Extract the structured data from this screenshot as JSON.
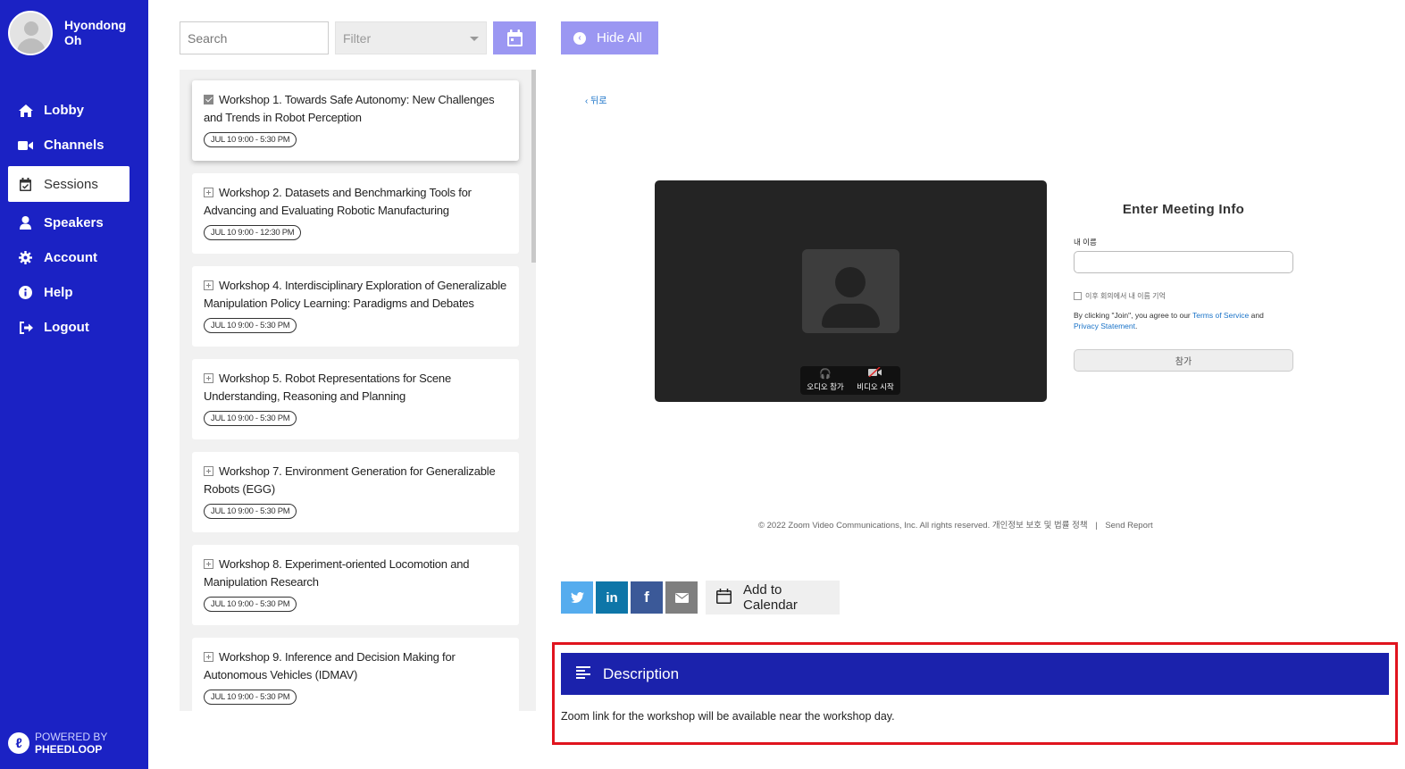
{
  "user": {
    "name": "Hyondong Oh"
  },
  "nav": {
    "items": [
      {
        "label": "Lobby",
        "icon": "home-icon"
      },
      {
        "label": "Channels",
        "icon": "video-camera-icon"
      },
      {
        "label": "Sessions",
        "icon": "calendar-check-icon",
        "active": true
      },
      {
        "label": "Speakers",
        "icon": "user-icon"
      },
      {
        "label": "Account",
        "icon": "gear-icon"
      },
      {
        "label": "Help",
        "icon": "info-icon"
      },
      {
        "label": "Logout",
        "icon": "sign-out-icon"
      }
    ]
  },
  "powered_by": {
    "line1": "POWERED BY",
    "line2": "PHEEDLOOP"
  },
  "toolbar": {
    "search_placeholder": "Search",
    "filter_label": "Filter",
    "hide_all_label": "Hide All"
  },
  "sessions": [
    {
      "title": "Workshop 1. Towards Safe Autonomy: New Challenges and Trends in Robot Perception",
      "time": "JUL 10 9:00 - 5:30 PM",
      "checked": true
    },
    {
      "title": "Workshop 2. Datasets and Benchmarking Tools for Advancing and Evaluating Robotic Manufacturing",
      "time": "JUL 10 9:00 - 12:30 PM",
      "checked": false
    },
    {
      "title": "Workshop 4. Interdisciplinary Exploration of Generalizable Manipulation Policy Learning: Paradigms and Debates",
      "time": "JUL 10 9:00 - 5:30 PM",
      "checked": false
    },
    {
      "title": "Workshop 5. Robot Representations for Scene Understanding, Reasoning and Planning",
      "time": "JUL 10 9:00 - 5:30 PM",
      "checked": false
    },
    {
      "title": "Workshop 7. Environment Generation for Generalizable Robots (EGG)",
      "time": "JUL 10 9:00 - 5:30 PM",
      "checked": false
    },
    {
      "title": "Workshop 8. Experiment-oriented Locomotion and Manipulation Research",
      "time": "JUL 10 9:00 - 5:30 PM",
      "checked": false
    },
    {
      "title": "Workshop 9. Inference and Decision Making for Autonomous Vehicles (IDMAV)",
      "time": "JUL 10 9:00 - 5:30 PM",
      "checked": false
    }
  ],
  "zoom": {
    "back_label": "‹ 뒤로",
    "audio_label": "오디오 참가",
    "video_label": "비디오 시작",
    "meeting_title": "Enter Meeting Info",
    "name_label": "내 이름",
    "remember_label": "이후 회의에서 내 이름 기억",
    "agree_prefix": "By clicking \"Join\", you agree to our ",
    "terms_label": "Terms of Service",
    "agree_and": " and",
    "privacy_label": "Privacy Statement",
    "join_label": "참가",
    "footer_text": "© 2022 Zoom Video Communications, Inc. All rights reserved. 개인정보 보호 및 법률 정책",
    "separator": "|",
    "send_report": "Send Report"
  },
  "share": {
    "twitter": "twitter-icon",
    "linkedin": "in",
    "facebook": "f",
    "email": "email-icon",
    "add_calendar_label": "Add to Calendar"
  },
  "description": {
    "header": "Description",
    "text": "Zoom link for the workshop will be available near the workshop day."
  },
  "colors": {
    "sidebar": "#1b22c4",
    "accent": "#9b97f2",
    "description_header": "#1b22ac",
    "highlight_frame": "#e0141e",
    "twitter": "#55acee",
    "linkedin": "#0e76a8",
    "facebook": "#3b5998",
    "email": "#7f7f7f"
  }
}
